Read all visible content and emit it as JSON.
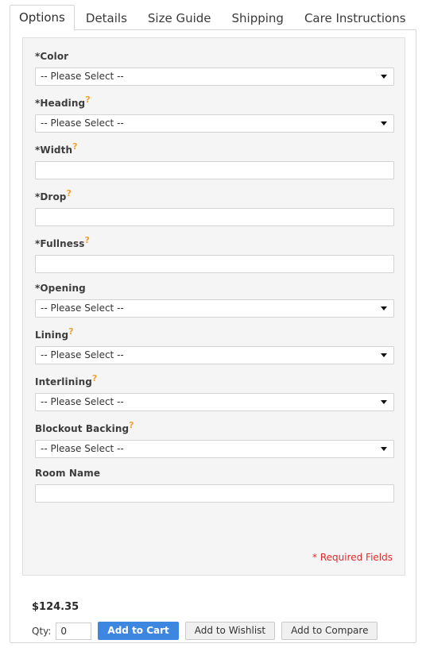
{
  "tabs": [
    {
      "label": "Options",
      "active": true
    },
    {
      "label": "Details",
      "active": false
    },
    {
      "label": "Size Guide",
      "active": false
    },
    {
      "label": "Shipping",
      "active": false
    },
    {
      "label": "Care Instructions",
      "active": false
    }
  ],
  "options_form": {
    "fields": [
      {
        "label": "*Color",
        "help": "",
        "type": "select",
        "value": "-- Please Select --"
      },
      {
        "label": "*Heading",
        "help": "?",
        "type": "select",
        "value": "-- Please Select --"
      },
      {
        "label": "*Width",
        "help": "?",
        "type": "text",
        "value": ""
      },
      {
        "label": "*Drop",
        "help": "?",
        "type": "text",
        "value": ""
      },
      {
        "label": "*Fullness",
        "help": "?",
        "type": "text",
        "value": ""
      },
      {
        "label": "*Opening",
        "help": "",
        "type": "select",
        "value": "-- Please Select --"
      },
      {
        "label": "Lining",
        "help": "?",
        "type": "select",
        "value": "-- Please Select --"
      },
      {
        "label": "Interlining",
        "help": "?",
        "type": "select",
        "value": "-- Please Select --"
      },
      {
        "label": "Blockout Backing",
        "help": "?",
        "type": "select",
        "value": "-- Please Select --"
      },
      {
        "label": "Room Name",
        "help": "",
        "type": "text",
        "value": ""
      }
    ],
    "required_note": "* Required Fields"
  },
  "purchase": {
    "price": "$124.35",
    "qty_label": "Qty:",
    "qty_value": "0",
    "add_to_cart_label": "Add to Cart",
    "add_to_wishlist_label": "Add to Wishlist",
    "add_to_compare_label": "Add to Compare"
  },
  "colors": {
    "accent_blue": "#3d87e0",
    "help_orange": "#f0a22e",
    "required_red": "#e02b2b",
    "panel_gray": "#f5f5f5"
  }
}
